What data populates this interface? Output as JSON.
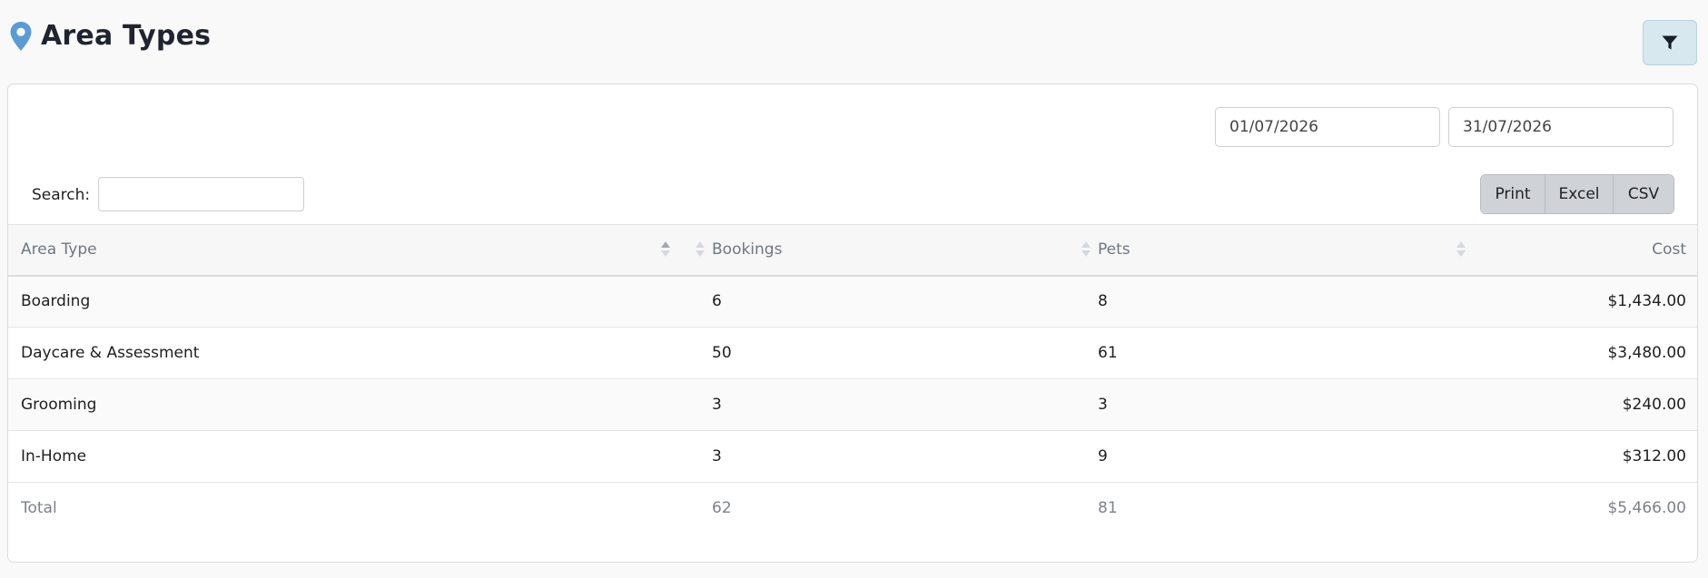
{
  "page": {
    "title": "Area Types",
    "icon": "map-pin-icon",
    "accent": "#5b9bd5"
  },
  "filter_button": {
    "icon": "filter-icon"
  },
  "date_range": {
    "from": "01/07/2026",
    "to": "31/07/2026"
  },
  "search": {
    "label": "Search:",
    "value": ""
  },
  "export_buttons": {
    "print": "Print",
    "excel": "Excel",
    "csv": "CSV"
  },
  "table": {
    "columns": {
      "area_type": "Area Type",
      "bookings": "Bookings",
      "pets": "Pets",
      "cost": "Cost"
    },
    "rows": [
      {
        "area_type": "Boarding",
        "bookings": "6",
        "pets": "8",
        "cost": "$1,434.00"
      },
      {
        "area_type": "Daycare & Assessment",
        "bookings": "50",
        "pets": "61",
        "cost": "$3,480.00"
      },
      {
        "area_type": "Grooming",
        "bookings": "3",
        "pets": "3",
        "cost": "$240.00"
      },
      {
        "area_type": "In-Home",
        "bookings": "3",
        "pets": "9",
        "cost": "$312.00"
      }
    ],
    "total": {
      "label": "Total",
      "bookings": "62",
      "pets": "81",
      "cost": "$5,466.00"
    }
  }
}
